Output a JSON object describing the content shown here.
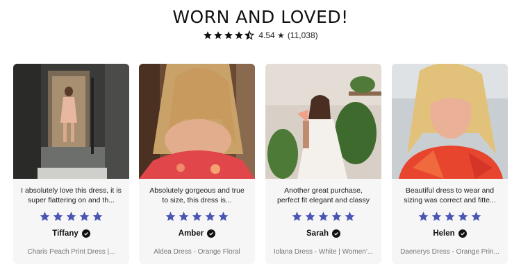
{
  "header": {
    "title": "WORN AND LOVED!",
    "rating_value": "4.54 ★",
    "rating_count": "(11,038)",
    "rating_stars": 4.54
  },
  "colors": {
    "star_blue": "#4a55b5",
    "header_star": "#111111",
    "card_bg": "#f6f6f6"
  },
  "reviews": [
    {
      "text": "I absolutely love this dress, it is super flattering on and th...",
      "stars": 5,
      "reviewer": "Tiffany",
      "product": "Charis Peach Print Dress |..."
    },
    {
      "text": "Absolutely gorgeous and true to size, this dress is...",
      "stars": 5,
      "reviewer": "Amber",
      "product": "Aldea Dress - Orange Floral"
    },
    {
      "text": "Another great purchase, perfect fit elegant and classy",
      "stars": 5,
      "reviewer": "Sarah",
      "product": "Iolana Dress - White | Women'..."
    },
    {
      "text": "Beautiful dress to wear and sizing was correct and fitte...",
      "stars": 5,
      "reviewer": "Helen",
      "product": "Daenerys Dress - Orange Prin..."
    }
  ]
}
